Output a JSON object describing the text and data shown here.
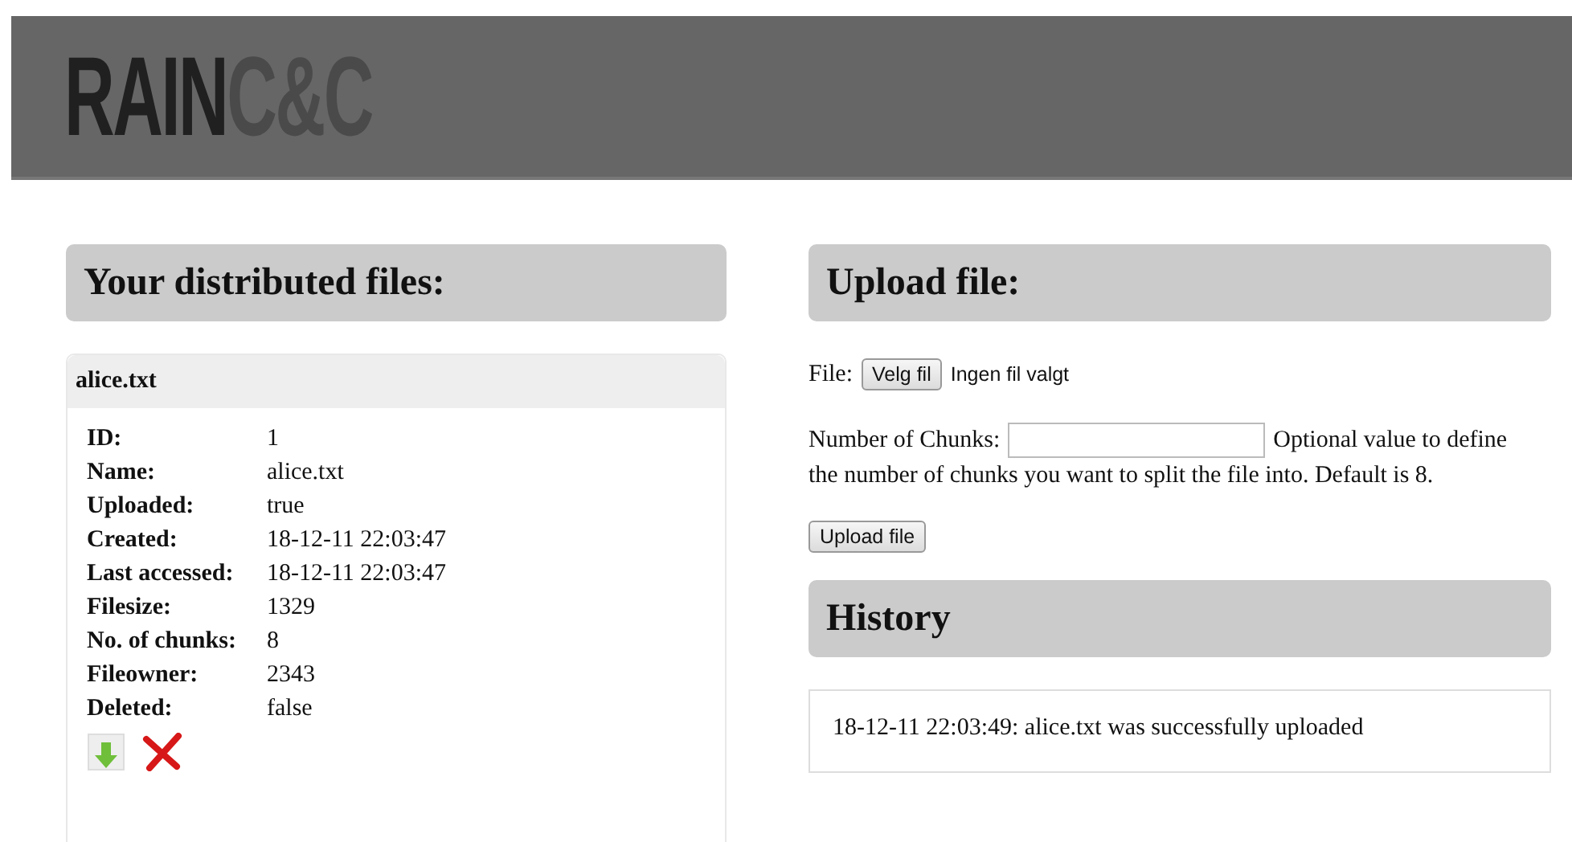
{
  "logo": {
    "primary": "RAIN",
    "secondary": "C&C"
  },
  "files": {
    "title": "Your distributed files:",
    "items": [
      {
        "name": "alice.txt",
        "fields": [
          {
            "label": "ID:",
            "value": "1"
          },
          {
            "label": "Name:",
            "value": "alice.txt"
          },
          {
            "label": "Uploaded:",
            "value": "true"
          },
          {
            "label": "Created:",
            "value": "18-12-11 22:03:47"
          },
          {
            "label": "Last accessed:",
            "value": "18-12-11 22:03:47"
          },
          {
            "label": "Filesize:",
            "value": "1329"
          },
          {
            "label": "No. of chunks:",
            "value": "8"
          },
          {
            "label": "Fileowner:",
            "value": "2343"
          },
          {
            "label": "Deleted:",
            "value": "false"
          }
        ]
      }
    ]
  },
  "upload": {
    "title": "Upload file:",
    "file_label": "File:",
    "choose_button": "Velg fil",
    "no_file": "Ingen fil valgt",
    "chunks_label": "Number of Chunks:",
    "chunks_help": [
      "Optional value to define",
      "the number of chunks you want to split the file into. Default is 8."
    ],
    "submit": "Upload file"
  },
  "history": {
    "title": "History",
    "entries": [
      "18-12-11 22:03:49: alice.txt was successfully uploaded"
    ]
  }
}
